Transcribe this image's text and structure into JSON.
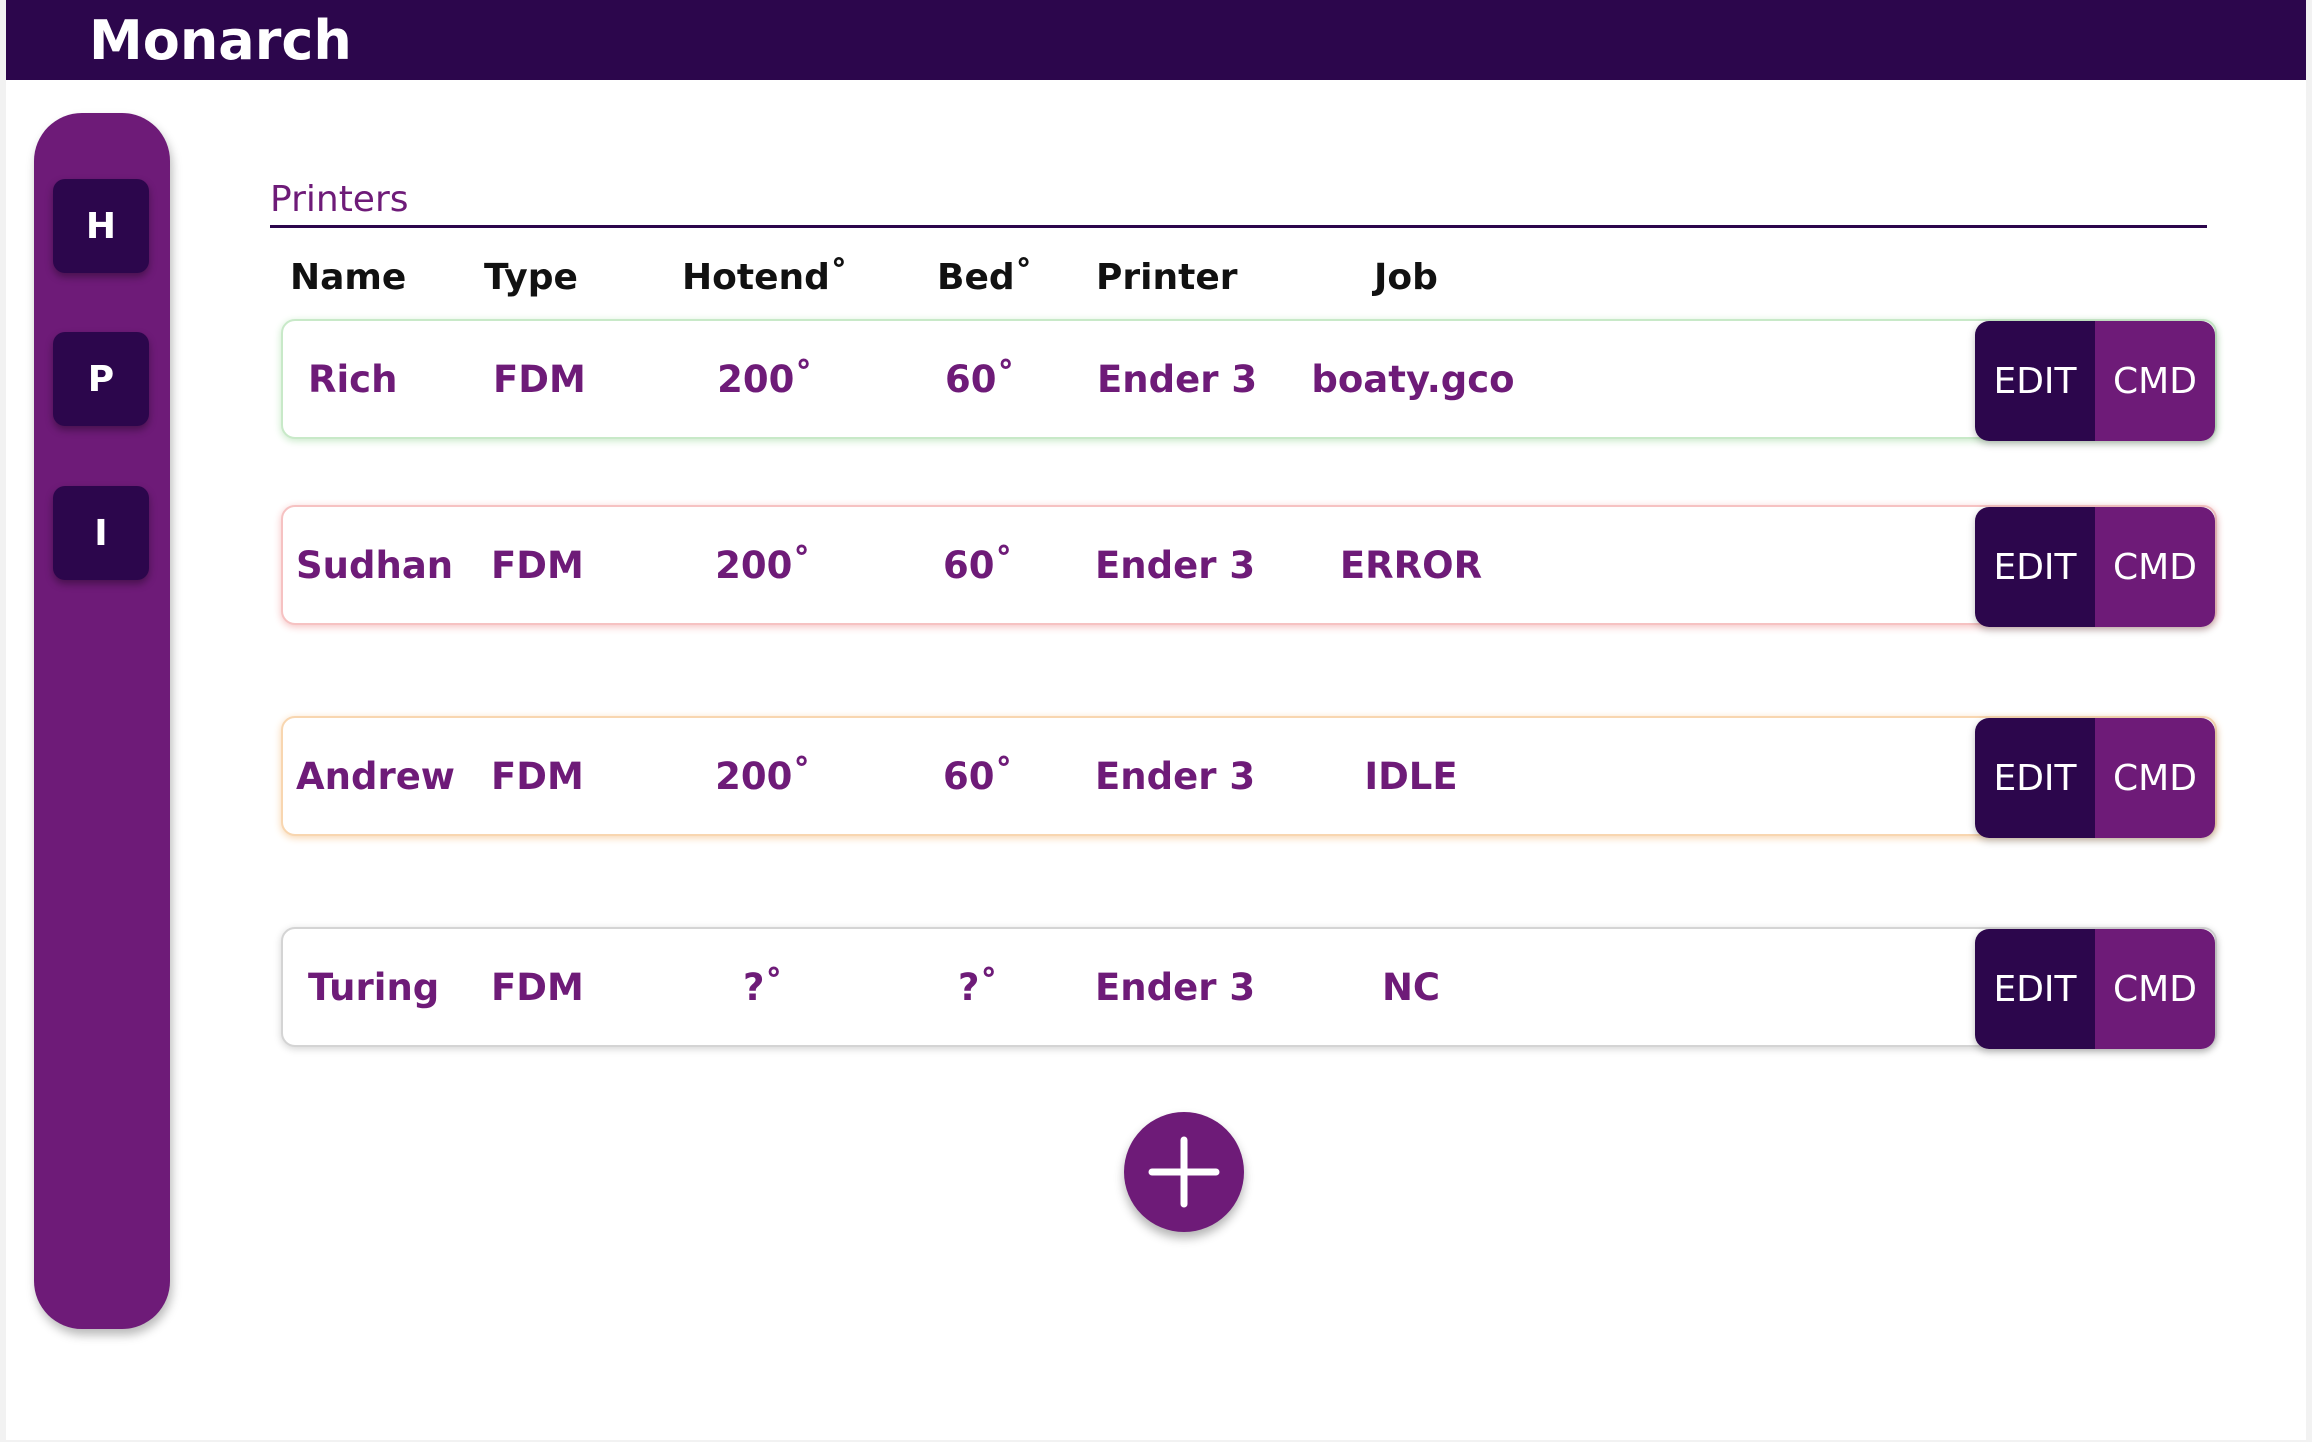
{
  "app": {
    "title": "Monarch"
  },
  "sidebar": {
    "items": [
      {
        "label": "H"
      },
      {
        "label": "P"
      },
      {
        "label": "I"
      }
    ]
  },
  "main": {
    "section_title": "Printers",
    "columns": [
      "Name",
      "Type",
      "Hotend˚",
      "Bed˚",
      "Printer",
      "Job"
    ],
    "rows": [
      {
        "name": "Rich",
        "type": "FDM",
        "hotend": "200˚",
        "bed": "60˚",
        "printer": "Ender 3",
        "job": "boaty.gco",
        "status_color": "#c8e9c8"
      },
      {
        "name": "Sudhan",
        "type": "FDM",
        "hotend": "200˚",
        "bed": "60˚",
        "printer": "Ender 3",
        "job": "ERROR",
        "status_color": "#f6c2c2"
      },
      {
        "name": "Andrew",
        "type": "FDM",
        "hotend": "200˚",
        "bed": "60˚",
        "printer": "Ender 3",
        "job": "IDLE",
        "status_color": "#f8d6b0"
      },
      {
        "name": "Turing",
        "type": "FDM",
        "hotend": "?˚",
        "bed": "?˚",
        "printer": "Ender 3",
        "job": "NC",
        "status_color": "#d4d4d4"
      }
    ],
    "edit_label": "EDIT",
    "cmd_label": "CMD",
    "add_icon": "plus-icon"
  },
  "colors": {
    "primary_dark": "#2c064c",
    "primary": "#6e1b78",
    "background": "#ffffff"
  }
}
